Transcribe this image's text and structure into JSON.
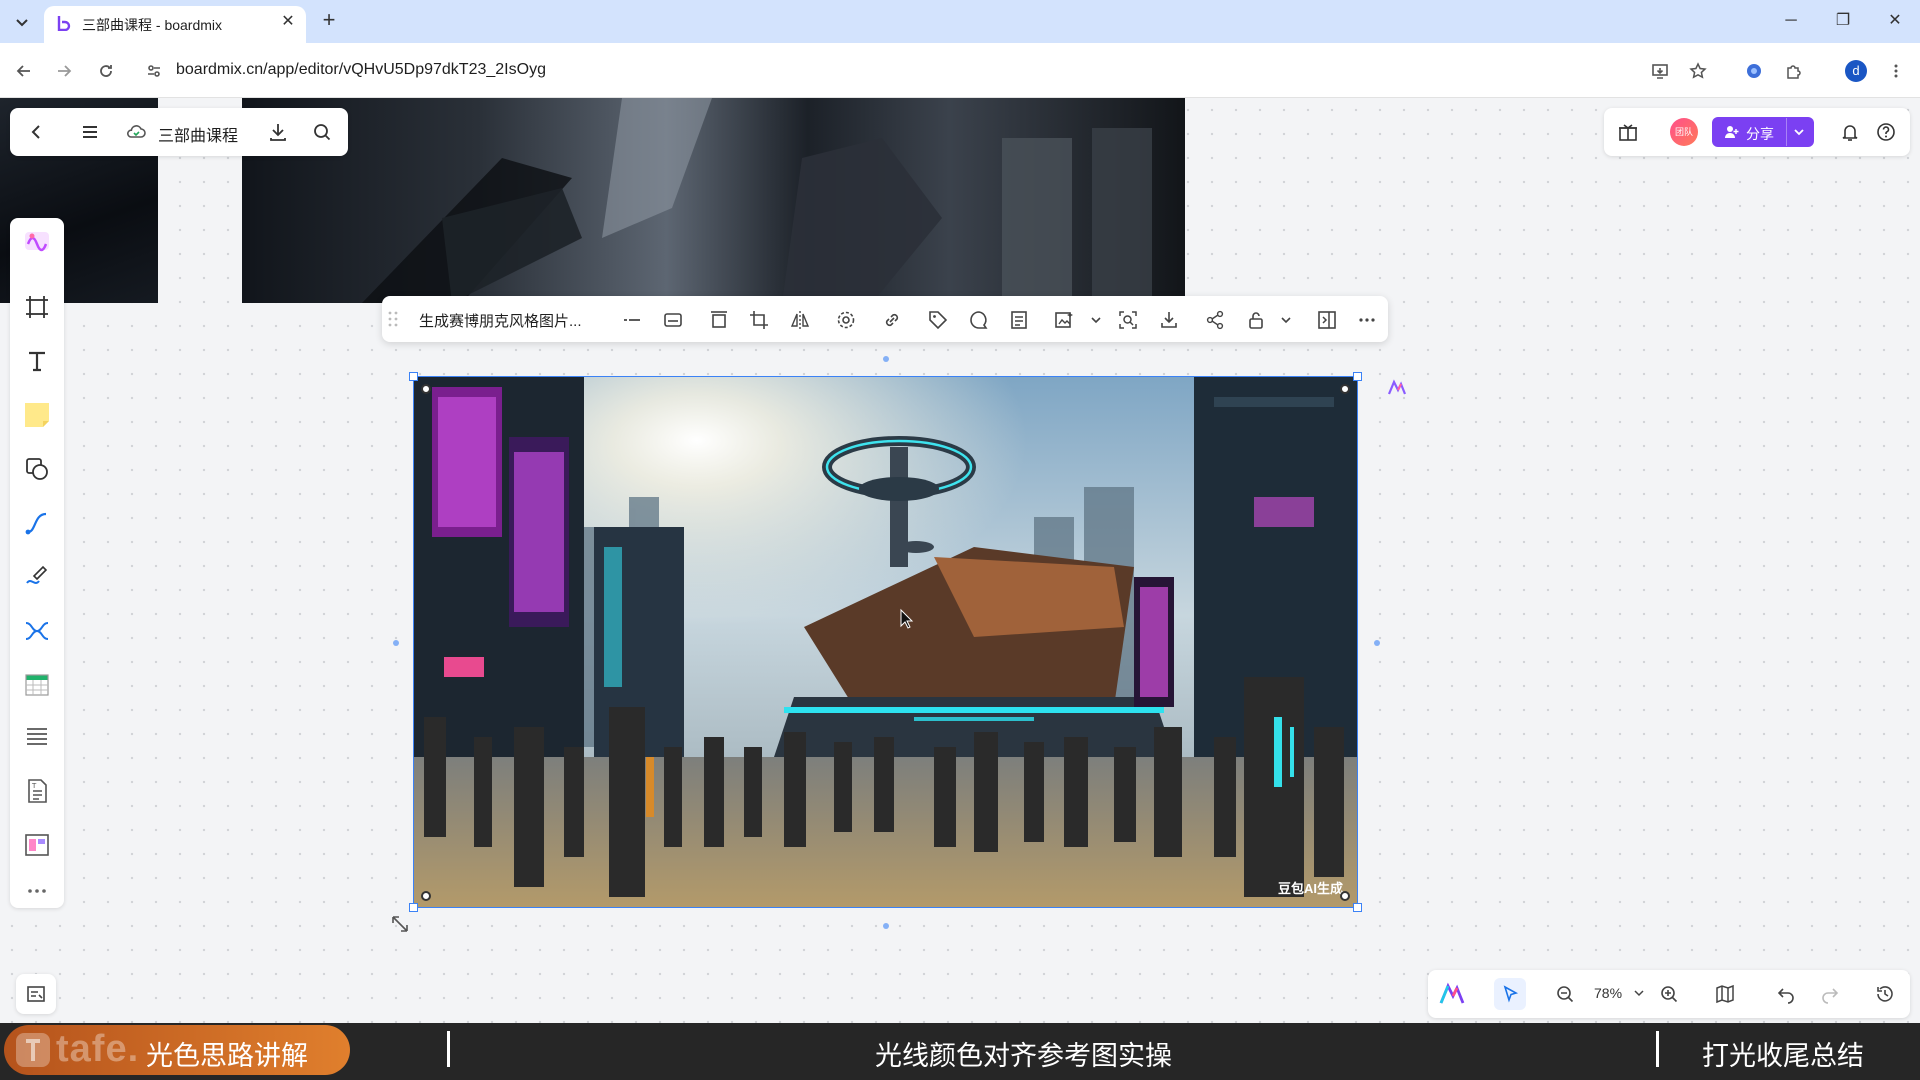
{
  "browser": {
    "tab_title": "三部曲课程 - boardmix",
    "url": "boardmix.cn/app/editor/vQHvU5Dp97dkT23_2IsOyg",
    "profile_initial": "d"
  },
  "board": {
    "title": "三部曲课程"
  },
  "topright": {
    "avatar_text": "团队",
    "share_label": "分享"
  },
  "left_tools": [
    "ai-tool",
    "frame",
    "text",
    "sticky-note",
    "shape",
    "connector",
    "pen",
    "mindmap",
    "table",
    "list",
    "document",
    "template",
    "more"
  ],
  "context_toolbar": {
    "title": "生成赛博朋克风格图片..."
  },
  "image": {
    "watermark": "豆包AI生成"
  },
  "zoom": {
    "level": "78%"
  },
  "subtitles": {
    "logo": "tafe.",
    "segments": [
      "光色思路讲解",
      "光线颜色对齐参考图实操",
      "打光收尾总结"
    ],
    "active_index": 0
  },
  "colors": {
    "accent": "#7b40f2",
    "selection": "#3b82f6",
    "tab_strip": "#d3e3fd"
  }
}
